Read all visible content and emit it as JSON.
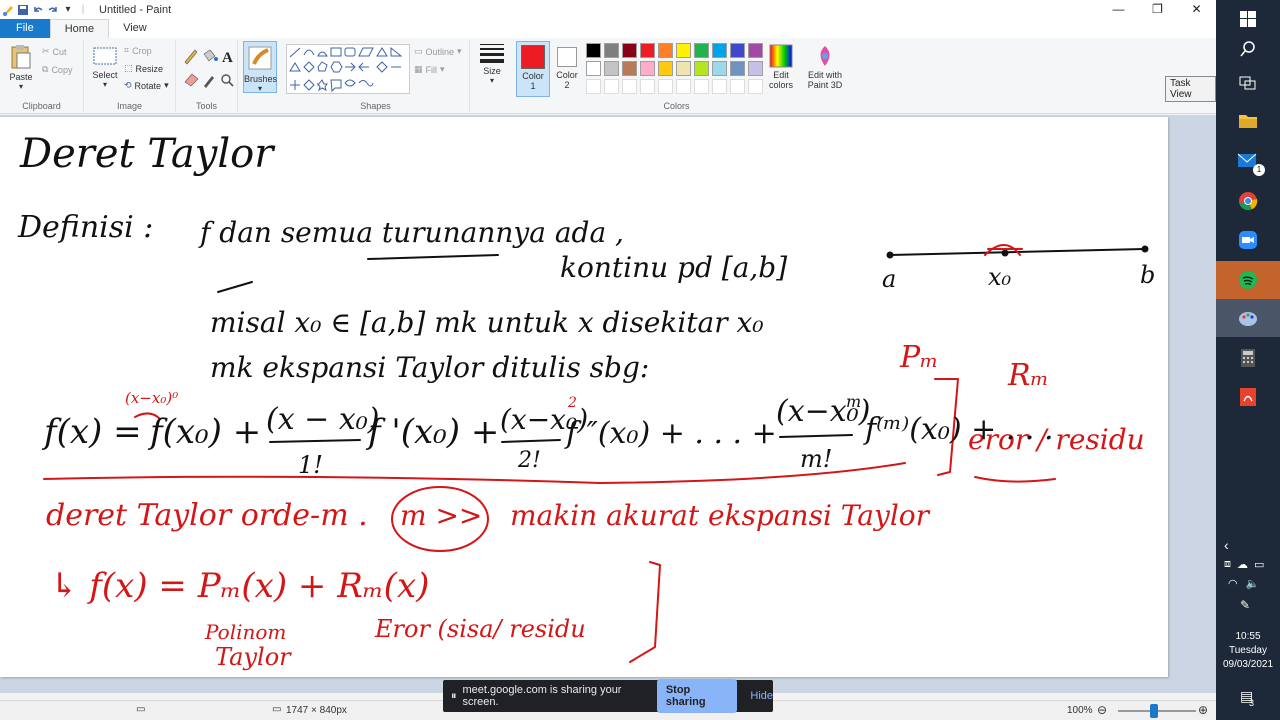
{
  "window": {
    "title": "Untitled - Paint"
  },
  "tabs": {
    "file": "File",
    "home": "Home",
    "view": "View"
  },
  "clipboard": {
    "paste": "Paste",
    "cut": "Cut",
    "copy": "Copy",
    "label": "Clipboard"
  },
  "image": {
    "select": "Select",
    "crop": "Crop",
    "resize": "Resize",
    "rotate": "Rotate",
    "label": "Image"
  },
  "tools": {
    "label": "Tools",
    "brushes": "Brushes"
  },
  "shapes": {
    "outline": "Outline",
    "fill": "Fill",
    "label": "Shapes"
  },
  "size": {
    "label": "Size"
  },
  "color1": {
    "label": "Color\n1",
    "line1": "Color",
    "line2": "1"
  },
  "color2": {
    "line1": "Color",
    "line2": "2"
  },
  "colors": {
    "label": "Colors",
    "edit_line1": "Edit",
    "edit_line2": "colors",
    "paint3d_line1": "Edit with",
    "paint3d_line2": "Paint 3D",
    "row1": [
      "#000000",
      "#7f7f7f",
      "#880015",
      "#ed1c24",
      "#ff7f27",
      "#fff200",
      "#22b14c",
      "#00a2e8",
      "#3f48cc",
      "#a349a4"
    ],
    "row2": [
      "#ffffff",
      "#c3c3c3",
      "#b97a57",
      "#ffaec9",
      "#ffc90e",
      "#efe4b0",
      "#b5e61d",
      "#99d9ea",
      "#7092be",
      "#c8bfe7"
    ],
    "primary": "#ed1c24",
    "secondary": "#ffffff"
  },
  "tooltip": "Task View",
  "status": {
    "dimensions": "1747 × 840px",
    "zoom": "100%"
  },
  "share": {
    "message": "meet.google.com is sharing your screen.",
    "stop": "Stop sharing",
    "hide": "Hide"
  },
  "clock": {
    "time": "10:55",
    "day": "Tuesday",
    "date": "09/03/2021"
  },
  "notification_count": "3",
  "mail_badge": "1",
  "note": {
    "title": "Deret Taylor",
    "definition": "Definisi :",
    "line1": "f dan semua turunannya ada ,",
    "line1b": "kontinu pd [a,b]",
    "line2": "misal x₀ ∈ [a,b] mk untuk x disekitar x₀",
    "line3": "mk ekspansi Taylor ditulis sbg:",
    "axis_a": "a",
    "axis_x0": "x₀",
    "axis_b": "b",
    "formula_lhs": "f(x) =",
    "formula_t0": "f(x₀) +",
    "formula_t1_num": "(x − x₀)",
    "formula_t1_den": "1!",
    "formula_t1_f": "f '(x₀) +",
    "formula_t2_num": "(x−x₀)",
    "formula_t2_exp": "2",
    "formula_t2_den": "2!",
    "formula_t2_f": "f ″(x₀) + . . . +",
    "formula_tm_num": "(x−x₀)",
    "formula_tm_exp": "m",
    "formula_tm_den": "m!",
    "formula_tm_f": "f⁽ᵐ⁾(x₀) + . . .",
    "small_red": "(x−x₀)⁰",
    "pm": "Pₘ",
    "rm": "Rₘ",
    "error": "eror / residu",
    "order": "deret Taylor orde-m .",
    "m_big": "m >>",
    "accurate": "makin akurat ekspansi Taylor",
    "decomp": "↳ f(x) = Pₘ(x) + Rₘ(x)",
    "poly": "Polinom",
    "poly2": "Taylor",
    "err2": "Eror (sisa/ residu"
  }
}
